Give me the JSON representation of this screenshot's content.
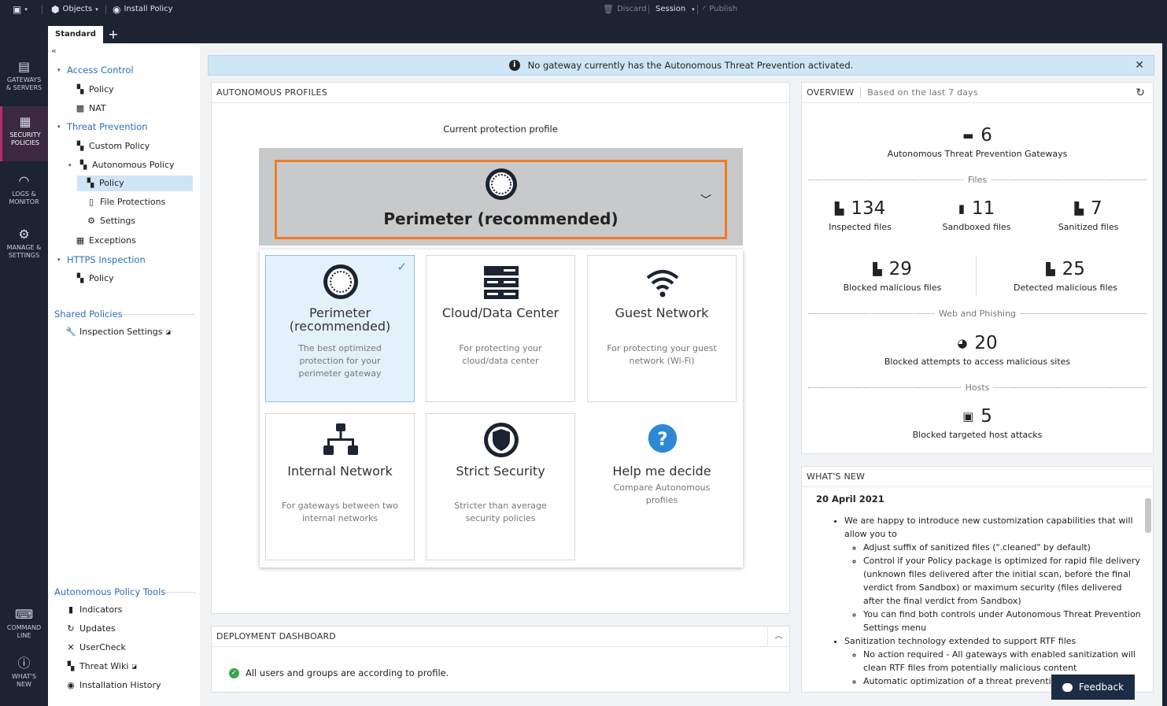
{
  "toolbar": {
    "objects": "Objects",
    "install_policy": "Install Policy",
    "discard": "Discard",
    "session": "Session",
    "publish": "Publish"
  },
  "tabs": {
    "standard": "Standard",
    "add": "+"
  },
  "rail": [
    {
      "label1": "GATEWAYS",
      "label2": "& SERVERS"
    },
    {
      "label1": "SECURITY",
      "label2": "POLICIES"
    },
    {
      "label1": "LOGS &",
      "label2": "MONITOR"
    },
    {
      "label1": "MANAGE &",
      "label2": "SETTINGS"
    },
    {
      "label1": "COMMAND",
      "label2": "LINE"
    },
    {
      "label1": "WHAT'S",
      "label2": "NEW"
    }
  ],
  "tree": {
    "collapse": "«",
    "access_control": "Access Control",
    "ac_policy": "Policy",
    "nat": "NAT",
    "threat_prevention": "Threat Prevention",
    "custom_policy": "Custom Policy",
    "autonomous_policy": "Autonomous Policy",
    "ap_policy": "Policy",
    "file_protections": "File Protections",
    "settings": "Settings",
    "exceptions": "Exceptions",
    "https_inspection": "HTTPS Inspection",
    "https_policy": "Policy",
    "shared_policies": "Shared Policies",
    "inspection_settings": "Inspection Settings",
    "tools_header": "Autonomous Policy Tools",
    "indicators": "Indicators",
    "updates": "Updates",
    "usercheck": "UserCheck",
    "threat_wiki": "Threat Wiki",
    "installation_history": "Installation History"
  },
  "banner": {
    "text": "No gateway currently has the Autonomous Threat Prevention activated."
  },
  "profiles": {
    "title": "AUTONOMOUS PROFILES",
    "current_label": "Current protection profile",
    "current_profile": "Perimeter (recommended)",
    "cards": [
      {
        "title": "Perimeter (recommended)",
        "desc": "The best optimized protection for your perimeter gateway"
      },
      {
        "title": "Cloud/Data Center",
        "desc": "For protecting your cloud/data center"
      },
      {
        "title": "Guest Network",
        "desc": "For protecting your guest network (Wi-Fi)"
      },
      {
        "title": "Internal Network",
        "desc": "For gateways between two internal networks"
      },
      {
        "title": "Strict Security",
        "desc": "Stricter than average security policies"
      },
      {
        "title": "Help me decide",
        "desc": "Compare Autonomous profiles"
      }
    ]
  },
  "deployment": {
    "title": "DEPLOYMENT DASHBOARD",
    "status": "All users and groups are according to profile."
  },
  "overview": {
    "title": "OVERVIEW",
    "subtitle": "Based on the last 7 days",
    "gateways": {
      "value": "6",
      "label": "Autonomous Threat Prevention Gateways"
    },
    "files_header": "Files",
    "inspected": {
      "value": "134",
      "label": "Inspected files"
    },
    "sandboxed": {
      "value": "11",
      "label": "Sandboxed files"
    },
    "sanitized": {
      "value": "7",
      "label": "Sanitized files"
    },
    "blocked_mal": {
      "value": "29",
      "label": "Blocked malicious files"
    },
    "detected_mal": {
      "value": "25",
      "label": "Detected malicious files"
    },
    "web_header": "Web and Phishing",
    "blocked_sites": {
      "value": "20",
      "label": "Blocked attempts to access malicious sites"
    },
    "hosts_header": "Hosts",
    "blocked_hosts": {
      "value": "5",
      "label": "Blocked targeted host attacks"
    }
  },
  "whats_new": {
    "title": "WHAT'S NEW",
    "date": "20 April 2021",
    "b1": "We are happy to introduce new customization capabilities that will allow you to",
    "b1a": "Adjust suffix of sanitized files (\".cleaned\" by default)",
    "b1b": "Control if your Policy package is optimized for rapid file delivery (unknown files delivered after the initial scan, before the final verdict from Sandbox) or maximum security (files delivered after the final verdict from Sandbox)",
    "b1c": "You can find both controls under Autonomous Threat Prevention Settings menu",
    "b2": "Sanitization technology extended to support RTF files",
    "b2a": "No action required - All gateways with enabled sanitization will clean RTF files from potentially malicious content",
    "b2b": "Automatic optimization of a threat prevention"
  },
  "feedback": "Feedback"
}
